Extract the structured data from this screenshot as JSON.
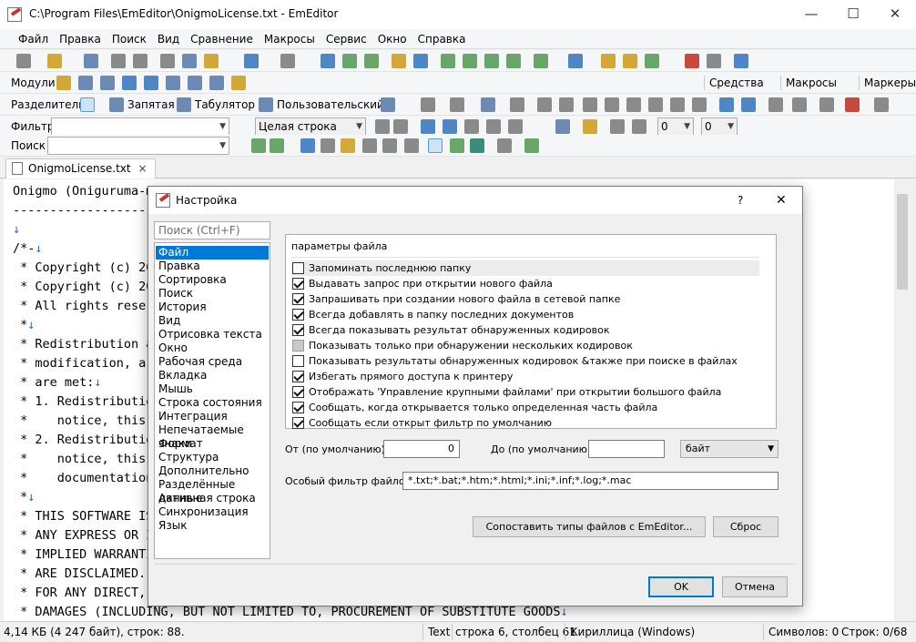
{
  "window": {
    "title": "C:\\Program Files\\EmEditor\\OnigmoLicense.txt - EmEditor",
    "min": "—",
    "max": "☐",
    "close": "✕"
  },
  "menu": [
    "Файл",
    "Правка",
    "Поиск",
    "Вид",
    "Сравнение",
    "Макросы",
    "Сервис",
    "Окно",
    "Справка"
  ],
  "toolbar2": {
    "modules": "Модули",
    "tools": "Средства",
    "macros": "Макросы",
    "markers": "Маркеры"
  },
  "toolbar3": {
    "separators": "Разделители",
    "comma": "Запятая",
    "tab": "Табулятор",
    "custom": "Пользовательский"
  },
  "filter_bar": {
    "label": "Фильтр",
    "mode": "Целая строка",
    "num1": "0",
    "num2": "0"
  },
  "search_bar": {
    "label": "Поиск"
  },
  "doc_tab": {
    "name": "OnigmoLicense.txt",
    "close": "×"
  },
  "editor_lines": [
    "Onigmo (Oniguruma-m) LICENSE",
    "-------------------",
    "",
    "/*-",
    " * Copyright (c) 20",
    " * Copyright (c) 20",
    " * All rights reser",
    " *",
    " * Redistribution a",
    " * modification, ar",
    " * are met:",
    " * 1. Redistributio",
    " *    notice, this",
    " * 2. Redistributio",
    " *    notice, this",
    " *    documentation",
    " *",
    " * THIS SOFTWARE IS",
    " * ANY EXPRESS OR I",
    " * IMPLIED WARRANTI",
    " * ARE DISCLAIMED.",
    " * FOR ANY DIRECT,",
    " * DAMAGES (INCLUDING, BUT NOT LIMITED TO, PROCUREMENT OF SUBSTITUTE GOODS"
  ],
  "newline_mark": "↓",
  "status": {
    "size": "4,14 КБ (4 247 байт), строк: 88.",
    "mode": "Text",
    "pos": "строка 6, столбец 61",
    "enc": "Кириллица (Windows)",
    "sym": "Символов: 0",
    "row": "Строк: 0/68"
  },
  "dialog": {
    "title": "Настройка",
    "help": "?",
    "close": "✕",
    "search_placeholder": "Поиск (Ctrl+F)",
    "nav": [
      "Файл",
      "Правка",
      "Сортировка",
      "Поиск",
      "История",
      "Вид",
      "Отрисовка текста",
      "Окно",
      "Рабочая среда",
      "Вкладка",
      "Мышь",
      "Строка состояния",
      "Интеграция",
      "Непечатаемые знаки",
      "Формат",
      "Структура",
      "Дополнительно",
      "Разделённые данные",
      "Активная строка",
      "Синхронизация",
      "Язык"
    ],
    "section": "параметры файла",
    "options": [
      {
        "label": "Запоминать последнюю папку",
        "state": "off"
      },
      {
        "label": "Выдавать запрос при открытии нового файла",
        "state": "on"
      },
      {
        "label": "Запрашивать при создании нового файла в сетевой папке",
        "state": "on"
      },
      {
        "label": "Всегда добавлять в папку последних документов",
        "state": "on"
      },
      {
        "label": "Всегда показывать результат обнаруженных кодировок",
        "state": "on"
      },
      {
        "label": "Показывать только при обнаружении нескольких кодировок",
        "state": "disabled"
      },
      {
        "label": "Показывать результаты обнаруженных кодировок &также при поиске в файлах",
        "state": "off"
      },
      {
        "label": "Избегать прямого доступа к принтеру",
        "state": "on"
      },
      {
        "label": "Отображать 'Управление крупными файлами' при открытии большого файла",
        "state": "on"
      },
      {
        "label": "Сообщать, когда открывается только определенная часть файла",
        "state": "on"
      },
      {
        "label": "Сообщать если открыт фильтр по умолчанию",
        "state": "on"
      }
    ],
    "from_label": "От (по умолчанию):",
    "from_value": "0",
    "to_label": "До (по умолчанию):",
    "to_value": "",
    "unit": "байт",
    "filter_label": "Особый фильтр файлов:",
    "filter_value": "*.txt;*.bat;*.htm;*.html;*.ini;*.inf;*.log;*.mac",
    "assoc_button": "Сопоставить типы файлов с EmEditor...",
    "reset_button": "Сброс",
    "ok_button": "OK",
    "cancel_button": "Отмена"
  }
}
